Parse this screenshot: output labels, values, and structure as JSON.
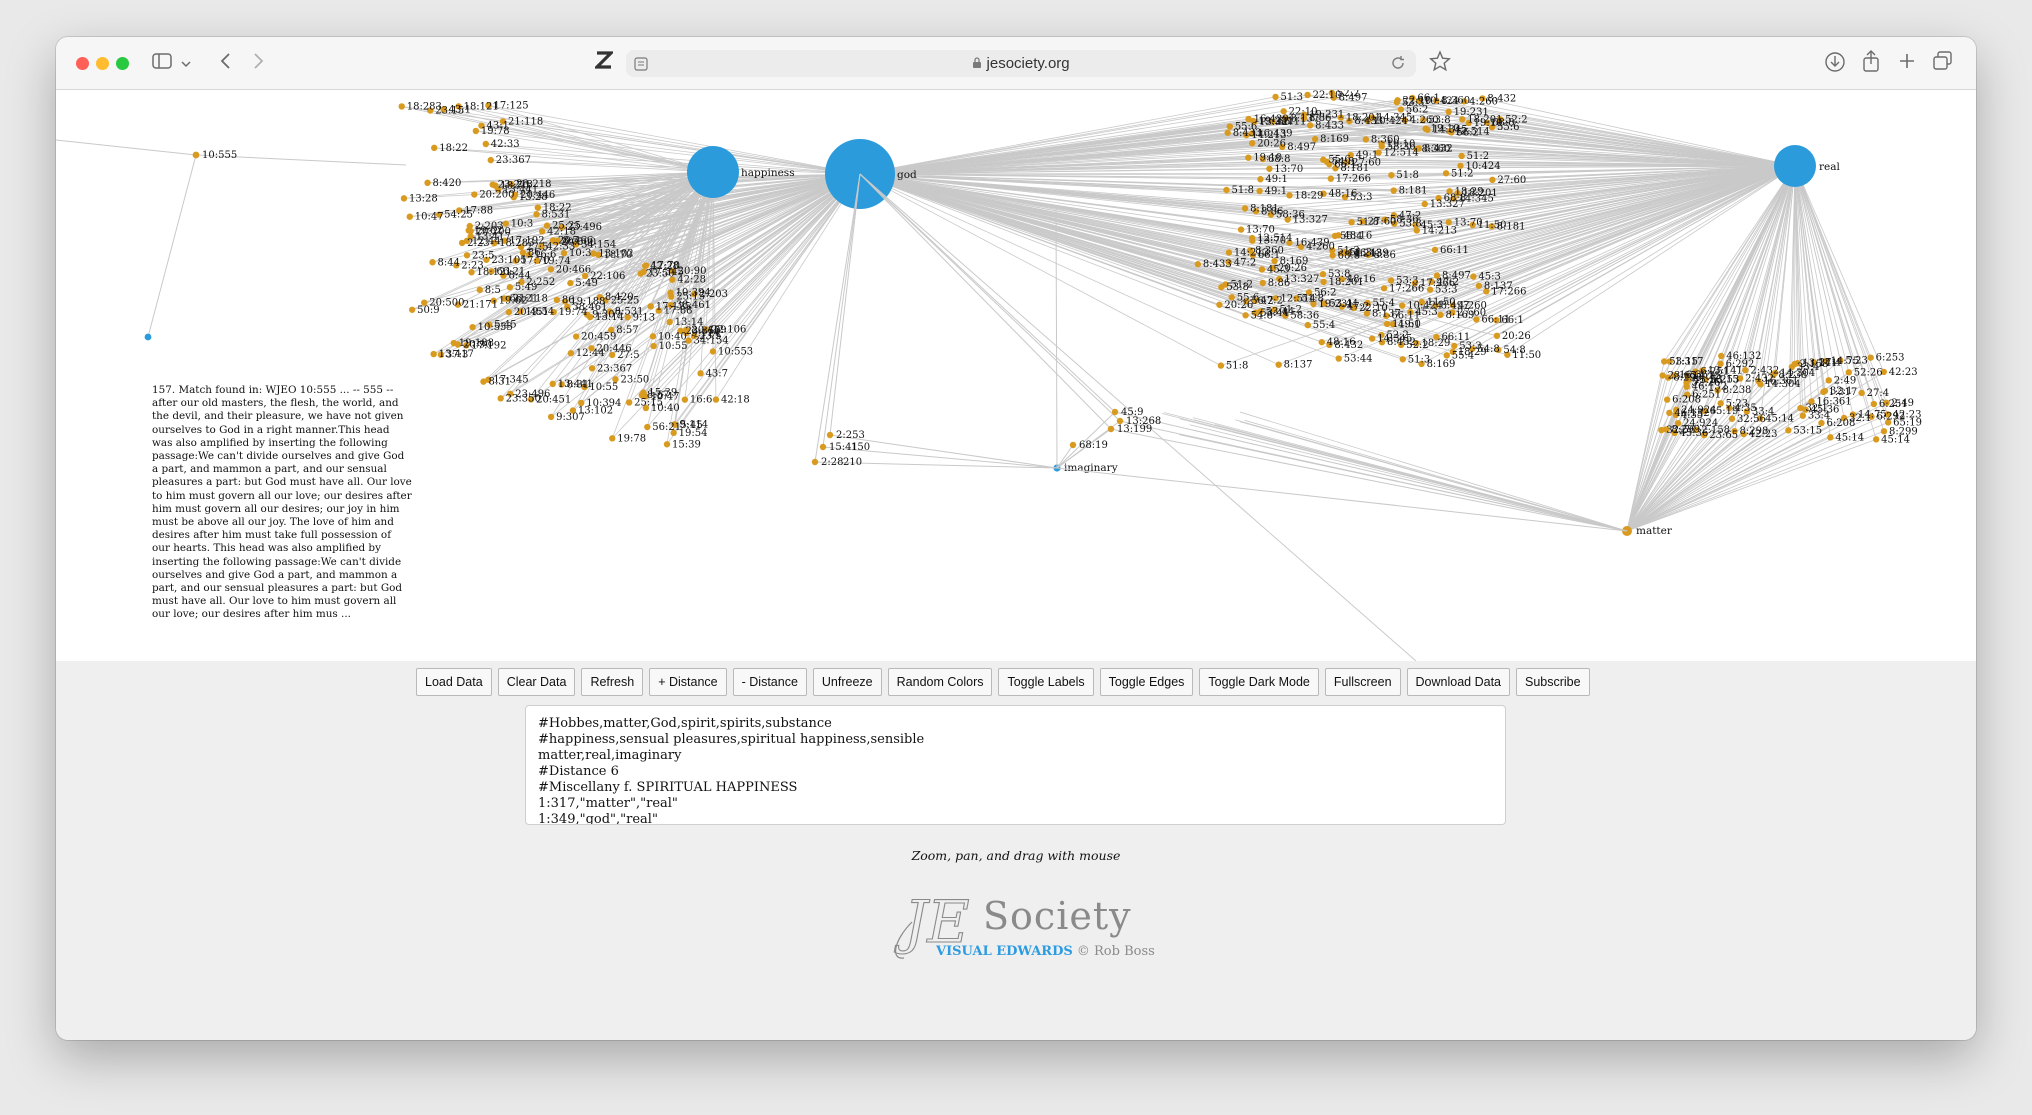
{
  "browser": {
    "url": "jesociety.org",
    "colors": {
      "close": "#ff5f57",
      "minimize": "#febc2e",
      "maximize": "#28c840"
    },
    "icons": [
      "sidebar-icon",
      "chevron-down-icon",
      "back-icon",
      "forward-icon",
      "zotero-icon",
      "reader-icon",
      "lock-icon",
      "reload-icon",
      "bookmark-star-icon",
      "download-icon",
      "share-icon",
      "new-tab-icon",
      "tab-overview-icon"
    ]
  },
  "graph": {
    "colors": {
      "hub": "#2c9bdc",
      "leaf": "#d99a20",
      "edge": "#c9c9c9"
    },
    "hubs": [
      {
        "label": "happiness",
        "weight": 2
      },
      {
        "label": "god",
        "weight": 3
      },
      {
        "label": "real",
        "weight": 2
      },
      {
        "label": "imaginary",
        "weight": 0
      },
      {
        "label": "matter",
        "weight": 0
      }
    ],
    "match_text": "157. Match found in: WJEO 10:555 ... -- 555 -- after our old masters, the flesh, the world, and the devil, and their pleasure, we have not given ourselves to God in a right manner.This head was also amplified by inserting the following passage:We can't divide ourselves and give God a part, and mammon a part, and our sensual pleasures a part: but God must have all. Our love to him must govern all our love; our desires after him must govern all our desires; our joy in him must be above all our joy. The love of him and desires after him must take full possession of our hearts. This head was also amplified by inserting the following passage:We can't divide ourselves and give God a part, and mammon a part, and our sensual pleasures a part: but God must have all. Our love to him must govern all our love; our desires after him mus ...",
    "labels": {
      "ref_10_555": "10:555",
      "imaginary_leaves": [
        "45:9",
        "13:268",
        "13:199",
        "68:19",
        "2:253",
        "15:41",
        "150",
        "2:28",
        "210"
      ],
      "left_cluster": [
        "8:5",
        "17:88",
        "66:21",
        "9:114",
        "13:417",
        "13:441",
        "23:218",
        "27:5",
        "18:70",
        "23:5",
        "23:50",
        "10:55",
        "20:451",
        "20:200",
        "19:78",
        "19:74",
        "18:283",
        "25:15",
        "86",
        "19:54",
        "13:102",
        "16:6",
        "19:62",
        "17:125",
        "20:466",
        "34:154",
        "10:47",
        "21:118",
        "17:192",
        "5:49",
        "8:420",
        "23:367",
        "8:31",
        "18:22",
        "38:461",
        "8:57",
        "9:307",
        "22:106",
        "12:44",
        "15:39",
        "19:188",
        "2:23",
        "10:40",
        "18:121",
        "2:203",
        "10:394",
        "17:345",
        "20:90",
        "20:500",
        "43:1",
        "25:25",
        "20:459",
        "23:350",
        "8:531",
        "42:33",
        "17:70",
        "20:446",
        "10:3",
        "8:44",
        "42:18",
        "10:553",
        "23:496",
        "13:28",
        "13:14",
        "5:45",
        "42:28",
        "9:13",
        "43:7",
        "2:252",
        "50:9",
        "23:105",
        "56:21",
        "54:25",
        "37:3",
        "23:15",
        "21:171"
      ],
      "center_cluster": [
        "66:11",
        "47:2",
        "51:8",
        "53:3",
        "55:6",
        "13:70",
        "18:201",
        "16:439",
        "19:231",
        "13:327",
        "18:29",
        "22:10",
        "58:36",
        "8:181",
        "8:432",
        "56:2",
        "52:2",
        "10:424",
        "8:497",
        "53:44",
        "54:8",
        "48:16",
        "14:345",
        "8:360",
        "8:86",
        "55:4",
        "8:433",
        "68:8",
        "49:1",
        "12:514",
        "66:1",
        "51:3",
        "8:169",
        "8:137",
        "53:8",
        "20:26",
        "19:10",
        "14:213",
        "51:2",
        "45:3",
        "17:266",
        "27:60",
        "11:50",
        "4:260"
      ],
      "right_cluster": [
        "32:1",
        "46:132",
        "14:75",
        "45:36",
        "42:23",
        "33:4",
        "16:361",
        "6:251",
        "53:15",
        "45:14",
        "65:19",
        "6:292",
        "6:208",
        "52:26",
        "24:924",
        "27:4",
        "8:299",
        "32:56",
        "13:141",
        "5:23",
        "8:298",
        "6:253",
        "2:158",
        "14:304",
        "23:65",
        "1:317",
        "2:49",
        "2:432",
        "8:238",
        "4:35"
      ]
    }
  },
  "buttons": [
    "Load Data",
    "Clear Data",
    "Refresh",
    "+ Distance",
    "- Distance",
    "Unfreeze",
    "Random Colors",
    "Toggle Labels",
    "Toggle Edges",
    "Toggle Dark Mode",
    "Fullscreen",
    "Download Data",
    "Subscribe"
  ],
  "editor_lines": [
    "#Hobbes,matter,God,spirit,spirits,substance",
    "#happiness,sensual pleasures,spiritual happiness,sensible",
    "matter,real,imaginary",
    "#Distance 6",
    "#Miscellany f. SPIRITUAL HAPPINESS",
    "1:317,\"matter\",\"real\"",
    "1:349,\"god\",\"real\""
  ],
  "hint": "Zoom, pan, and drag with mouse",
  "logo": {
    "monogram": "JE",
    "wordmark": "Society",
    "brand": "VISUAL EDWARDS",
    "credit": "© Rob Boss"
  }
}
